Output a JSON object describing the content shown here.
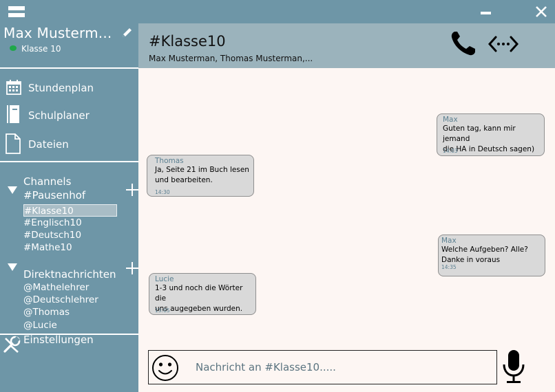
{
  "titlebar": {
    "menu_icon": "menu-icon",
    "minimize_icon": "minimize-icon",
    "close_icon": "close-icon"
  },
  "profile": {
    "name": "Max Musterm...",
    "status": "Klasse 10",
    "edit_icon": "pencil-icon",
    "status_color": "#1fa84a"
  },
  "nav": [
    {
      "label": "Stundenplan",
      "icon": "calendar-icon"
    },
    {
      "label": "Schulplaner",
      "icon": "book-icon"
    },
    {
      "label": "Dateien",
      "icon": "file-icon"
    }
  ],
  "channels": {
    "title": "Channels",
    "items": [
      "#Pausenhof",
      "#Klasse10",
      "#Englisch10",
      "#Deutsch10",
      "#Mathe10"
    ],
    "active": "#Klasse10"
  },
  "direct": {
    "title": "Direktnachrichten",
    "items": [
      "@Mathelehrer",
      "@Deutschlehrer",
      "@Thomas",
      "@Lucie"
    ]
  },
  "settings": {
    "label": "Einstellungen",
    "icon": "wrench-icon"
  },
  "chat": {
    "title": "#Klasse10",
    "members": "Max Musterman, Thomas Musterman,...",
    "call_icon": "phone-icon",
    "share_icon": "code-arrows-icon"
  },
  "messages": [
    {
      "sender": "Max",
      "text": "Guten tag, kann mir jemand\ndie HA in Deutsch sagen)",
      "time": "14:03",
      "side": "right"
    },
    {
      "sender": "Thomas",
      "text": "Ja, Seite 21 im Buch lesen\nund bearbeiten.",
      "time": "14:30",
      "side": "left"
    },
    {
      "sender": "Max",
      "text": "Welche Aufgeben? Alle?\nDanke in voraus",
      "time": "14:35",
      "side": "right"
    },
    {
      "sender": "Lucie",
      "text": "1-3 und noch die Wörter die\nuns augegeben wurden.",
      "time": "15:05",
      "side": "left"
    }
  ],
  "composer": {
    "placeholder": "Nachricht an #Klasse10.....",
    "emoji_icon": "smiley-icon",
    "mic_icon": "microphone-icon"
  },
  "colors": {
    "sidebar": "#6e96a7",
    "header": "#9bb3bc",
    "chat_bg": "#fdf6f3",
    "bubble": "#d9d9d9",
    "accent_text": "#5b7f90"
  }
}
